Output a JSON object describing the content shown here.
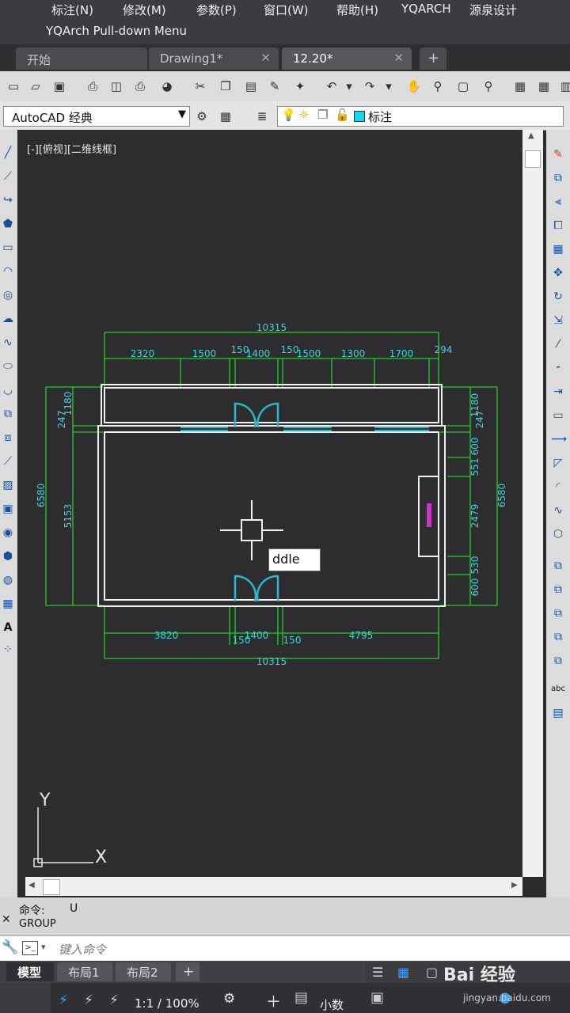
{
  "menu": {
    "items": [
      "标注(N)",
      "修改(M)",
      "参数(P)",
      "窗口(W)",
      "帮助(H)",
      "YQARCH",
      "源泉设计"
    ],
    "subtitle": "YQArch Pull-down Menu"
  },
  "tabs": [
    {
      "label": "开始",
      "close": ""
    },
    {
      "label": "Drawing1*",
      "close": "✕"
    },
    {
      "label": "12.20*",
      "close": "✕"
    },
    {
      "label": "+",
      "close": ""
    }
  ],
  "toolbar": {
    "workspace": "AutoCAD 经典",
    "layer_name": "标注"
  },
  "viewport": {
    "label": "[-][俯视][二维线框]"
  },
  "drawing": {
    "dimensions_top_total": "10315",
    "dimensions_top": [
      "2320",
      "1500",
      "150",
      "1400",
      "150",
      "1500",
      "1300",
      "1700",
      "294"
    ],
    "dimensions_bottom": [
      "3820",
      "1400",
      "150",
      "150",
      "4795"
    ],
    "dimensions_bottom_total": "10315",
    "dimensions_left": [
      "6580",
      "5153",
      "247",
      "1180"
    ],
    "dimensions_right": [
      "6580",
      "1180",
      "247",
      "600",
      "551",
      "2479",
      "530",
      "600"
    ],
    "dynamic_input": "ddle",
    "ucs_y": "Y",
    "ucs_x": "X"
  },
  "command": {
    "history": [
      {
        "label": "命令:",
        "value": "U"
      },
      {
        "label": "GROUP",
        "value": ""
      }
    ],
    "placeholder": "键入命令"
  },
  "layout_tabs": [
    "模型",
    "布局1",
    "布局2",
    "+"
  ],
  "status": {
    "scale": "1:1 / 100%",
    "units": "小数"
  },
  "watermark": {
    "main": "Bai 经验",
    "sub": "jingyan.baidu.com"
  },
  "colors": {
    "dimension": "#20d020",
    "dim_text": "#38d4e0",
    "wall": "#f0f0f0",
    "window": "#20b8c8",
    "door": "#2ab8c8",
    "furniture_text": "#d030d0"
  }
}
